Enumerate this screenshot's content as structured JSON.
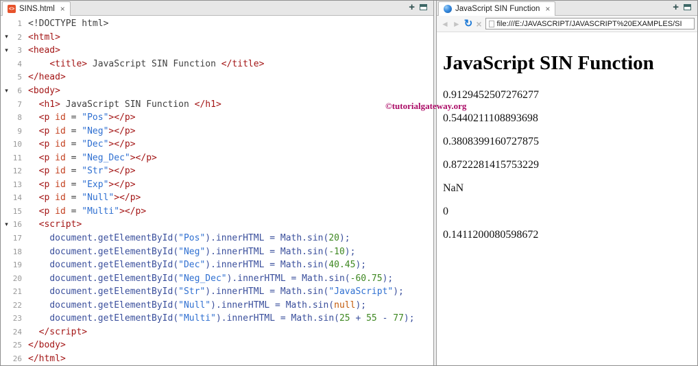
{
  "watermark": "©tutorialgateway.org",
  "icons": {
    "close": "×",
    "plus": "+",
    "back": "◄",
    "forward": "►",
    "refresh": "↻",
    "stop": "×",
    "fold": "▾",
    "file": "<>"
  },
  "colors": {
    "editor_tag": "#a31515",
    "editor_attr": "#c3401f",
    "editor_string": "#2e6fd1",
    "editor_number": "#3e8721",
    "editor_js": "#3a4f9c",
    "watermark": "#ab0b66",
    "refresh_blue": "#1e7ad6",
    "html_icon_orange": "#e7532c"
  },
  "editor": {
    "tab_title": "SINS.html",
    "lines": [
      {
        "n": 1,
        "fold": false,
        "s": [
          [
            "plain",
            "<!DOCTYPE html>"
          ]
        ]
      },
      {
        "n": 2,
        "fold": true,
        "s": [
          [
            "tag",
            "<html>"
          ]
        ]
      },
      {
        "n": 3,
        "fold": true,
        "s": [
          [
            "tag",
            "<head>"
          ]
        ]
      },
      {
        "n": 4,
        "fold": false,
        "s": [
          [
            "plain",
            "    "
          ],
          [
            "tag",
            "<title>"
          ],
          [
            "plain",
            " JavaScript SIN Function "
          ],
          [
            "tag",
            "</title>"
          ]
        ]
      },
      {
        "n": 5,
        "fold": false,
        "s": [
          [
            "tag",
            "</head>"
          ]
        ]
      },
      {
        "n": 6,
        "fold": true,
        "s": [
          [
            "tag",
            "<body>"
          ]
        ]
      },
      {
        "n": 7,
        "fold": false,
        "s": [
          [
            "plain",
            "  "
          ],
          [
            "tag",
            "<h1>"
          ],
          [
            "plain",
            " JavaScript SIN Function "
          ],
          [
            "tag",
            "</h1>"
          ]
        ]
      },
      {
        "n": 8,
        "fold": false,
        "s": [
          [
            "plain",
            "  "
          ],
          [
            "tag",
            "<p"
          ],
          [
            "plain",
            " "
          ],
          [
            "attr",
            "id"
          ],
          [
            "plain",
            " = "
          ],
          [
            "str",
            "\"Pos\""
          ],
          [
            "tag",
            "></p>"
          ]
        ]
      },
      {
        "n": 9,
        "fold": false,
        "s": [
          [
            "plain",
            "  "
          ],
          [
            "tag",
            "<p"
          ],
          [
            "plain",
            " "
          ],
          [
            "attr",
            "id"
          ],
          [
            "plain",
            " = "
          ],
          [
            "str",
            "\"Neg\""
          ],
          [
            "tag",
            "></p>"
          ]
        ]
      },
      {
        "n": 10,
        "fold": false,
        "s": [
          [
            "plain",
            "  "
          ],
          [
            "tag",
            "<p"
          ],
          [
            "plain",
            " "
          ],
          [
            "attr",
            "id"
          ],
          [
            "plain",
            " = "
          ],
          [
            "str",
            "\"Dec\""
          ],
          [
            "tag",
            "></p>"
          ]
        ]
      },
      {
        "n": 11,
        "fold": false,
        "s": [
          [
            "plain",
            "  "
          ],
          [
            "tag",
            "<p"
          ],
          [
            "plain",
            " "
          ],
          [
            "attr",
            "id"
          ],
          [
            "plain",
            " = "
          ],
          [
            "str",
            "\"Neg_Dec\""
          ],
          [
            "tag",
            "></p>"
          ]
        ]
      },
      {
        "n": 12,
        "fold": false,
        "s": [
          [
            "plain",
            "  "
          ],
          [
            "tag",
            "<p"
          ],
          [
            "plain",
            " "
          ],
          [
            "attr",
            "id"
          ],
          [
            "plain",
            " = "
          ],
          [
            "str",
            "\"Str\""
          ],
          [
            "tag",
            "></p>"
          ]
        ]
      },
      {
        "n": 13,
        "fold": false,
        "s": [
          [
            "plain",
            "  "
          ],
          [
            "tag",
            "<p"
          ],
          [
            "plain",
            " "
          ],
          [
            "attr",
            "id"
          ],
          [
            "plain",
            " = "
          ],
          [
            "str",
            "\"Exp\""
          ],
          [
            "tag",
            "></p>"
          ]
        ]
      },
      {
        "n": 14,
        "fold": false,
        "s": [
          [
            "plain",
            "  "
          ],
          [
            "tag",
            "<p"
          ],
          [
            "plain",
            " "
          ],
          [
            "attr",
            "id"
          ],
          [
            "plain",
            " = "
          ],
          [
            "str",
            "\"Null\""
          ],
          [
            "tag",
            "></p>"
          ]
        ]
      },
      {
        "n": 15,
        "fold": false,
        "s": [
          [
            "plain",
            "  "
          ],
          [
            "tag",
            "<p"
          ],
          [
            "plain",
            " "
          ],
          [
            "attr",
            "id"
          ],
          [
            "plain",
            " = "
          ],
          [
            "str",
            "\"Multi\""
          ],
          [
            "tag",
            "></p>"
          ]
        ]
      },
      {
        "n": 16,
        "fold": true,
        "s": [
          [
            "plain",
            "  "
          ],
          [
            "tag",
            "<script>"
          ]
        ]
      },
      {
        "n": 17,
        "fold": false,
        "s": [
          [
            "plain",
            "    "
          ],
          [
            "js",
            "document.getElementById("
          ],
          [
            "str",
            "\"Pos\""
          ],
          [
            "js",
            ").innerHTML = Math.sin("
          ],
          [
            "num",
            "20"
          ],
          [
            "js",
            ");"
          ]
        ]
      },
      {
        "n": 18,
        "fold": false,
        "s": [
          [
            "plain",
            "    "
          ],
          [
            "js",
            "document.getElementById("
          ],
          [
            "str",
            "\"Neg\""
          ],
          [
            "js",
            ").innerHTML = Math.sin("
          ],
          [
            "num",
            "-10"
          ],
          [
            "js",
            ");"
          ]
        ]
      },
      {
        "n": 19,
        "fold": false,
        "s": [
          [
            "plain",
            "    "
          ],
          [
            "js",
            "document.getElementById("
          ],
          [
            "str",
            "\"Dec\""
          ],
          [
            "js",
            ").innerHTML = Math.sin("
          ],
          [
            "num",
            "40.45"
          ],
          [
            "js",
            ");"
          ]
        ]
      },
      {
        "n": 20,
        "fold": false,
        "s": [
          [
            "plain",
            "    "
          ],
          [
            "js",
            "document.getElementById("
          ],
          [
            "str",
            "\"Neg_Dec\""
          ],
          [
            "js",
            ").innerHTML = Math.sin("
          ],
          [
            "num",
            "-60.75"
          ],
          [
            "js",
            ");"
          ]
        ]
      },
      {
        "n": 21,
        "fold": false,
        "s": [
          [
            "plain",
            "    "
          ],
          [
            "js",
            "document.getElementById("
          ],
          [
            "str",
            "\"Str\""
          ],
          [
            "js",
            ").innerHTML = Math.sin("
          ],
          [
            "str",
            "\"JavaScript\""
          ],
          [
            "js",
            ");"
          ]
        ]
      },
      {
        "n": 22,
        "fold": false,
        "s": [
          [
            "plain",
            "    "
          ],
          [
            "js",
            "document.getElementById("
          ],
          [
            "str",
            "\"Null\""
          ],
          [
            "js",
            ").innerHTML = Math.sin("
          ],
          [
            "atom",
            "null"
          ],
          [
            "js",
            ");"
          ]
        ]
      },
      {
        "n": 23,
        "fold": false,
        "s": [
          [
            "plain",
            "    "
          ],
          [
            "js",
            "document.getElementById("
          ],
          [
            "str",
            "\"Multi\""
          ],
          [
            "js",
            ").innerHTML = Math.sin("
          ],
          [
            "num",
            "25"
          ],
          [
            "js",
            " + "
          ],
          [
            "num",
            "55"
          ],
          [
            "js",
            " - "
          ],
          [
            "num",
            "77"
          ],
          [
            "js",
            ");"
          ]
        ]
      },
      {
        "n": 24,
        "fold": false,
        "s": [
          [
            "plain",
            "  "
          ],
          [
            "tag",
            "</script>"
          ]
        ]
      },
      {
        "n": 25,
        "fold": false,
        "s": [
          [
            "tag",
            "</body>"
          ]
        ]
      },
      {
        "n": 26,
        "fold": false,
        "s": [
          [
            "tag",
            "</html>"
          ]
        ]
      }
    ]
  },
  "browser": {
    "tab_title": "JavaScript SIN Function",
    "address": "file:///E:/JAVASCRIPT/JAVASCRIPT%20EXAMPLES/SI",
    "page": {
      "heading": "JavaScript SIN Function",
      "values": [
        "0.9129452507276277",
        "0.5440211108893698",
        "0.3808399160727875",
        "0.8722281415753229",
        "NaN",
        "0",
        "0.1411200080598672"
      ]
    }
  }
}
